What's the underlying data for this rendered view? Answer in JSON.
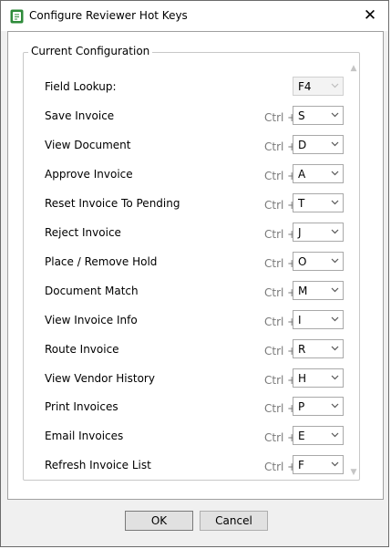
{
  "window": {
    "title": "Configure Reviewer Hot Keys"
  },
  "group": {
    "title": "Current Configuration"
  },
  "modifier": "Ctrl +",
  "rows": [
    {
      "label": "Field Lookup:",
      "key": "F4"
    },
    {
      "label": "Save Invoice",
      "key": "S"
    },
    {
      "label": "View Document",
      "key": "D"
    },
    {
      "label": "Approve Invoice",
      "key": "A"
    },
    {
      "label": "Reset Invoice To Pending",
      "key": "T"
    },
    {
      "label": "Reject Invoice",
      "key": "J"
    },
    {
      "label": "Place / Remove Hold",
      "key": "O"
    },
    {
      "label": "Document Match",
      "key": "M"
    },
    {
      "label": "View Invoice Info",
      "key": "I"
    },
    {
      "label": "Route Invoice",
      "key": "R"
    },
    {
      "label": "View Vendor History",
      "key": "H"
    },
    {
      "label": "Print Invoices",
      "key": "P"
    },
    {
      "label": "Email Invoices",
      "key": "E"
    },
    {
      "label": "Refresh Invoice List",
      "key": "F"
    }
  ],
  "buttons": {
    "ok": "OK",
    "cancel": "Cancel"
  },
  "icons": {
    "app": "app-icon",
    "close": "close-icon",
    "dropdown": "chevron-down-icon"
  },
  "colors": {
    "app_icon": "#2e8b3a"
  }
}
